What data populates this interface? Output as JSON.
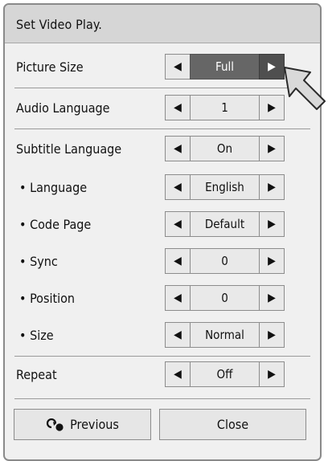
{
  "dialog": {
    "title": "Set Video Play."
  },
  "rows": [
    {
      "label": "Picture Size",
      "value": "Full"
    },
    {
      "label": "Audio Language",
      "value": "1"
    },
    {
      "label": "Subtitle Language",
      "value": "On"
    },
    {
      "label": "• Language",
      "value": "English"
    },
    {
      "label": "• Code Page",
      "value": "Default"
    },
    {
      "label": "• Sync",
      "value": "0"
    },
    {
      "label": "• Position",
      "value": "0"
    },
    {
      "label": "• Size",
      "value": "Normal"
    },
    {
      "label": "Repeat",
      "value": "Off"
    }
  ],
  "arrows": {
    "left": "◀",
    "right": "▶"
  },
  "buttons": {
    "previous": "Previous",
    "close": "Close"
  },
  "icons": {
    "previous": "back-arrow-icon",
    "cursor": "pointer-cursor-icon"
  },
  "colors": {
    "active_value": "#666666",
    "active_arrow": "#4f4f4f",
    "panel": "#f0f0f0",
    "titlebar": "#d6d6d6"
  }
}
